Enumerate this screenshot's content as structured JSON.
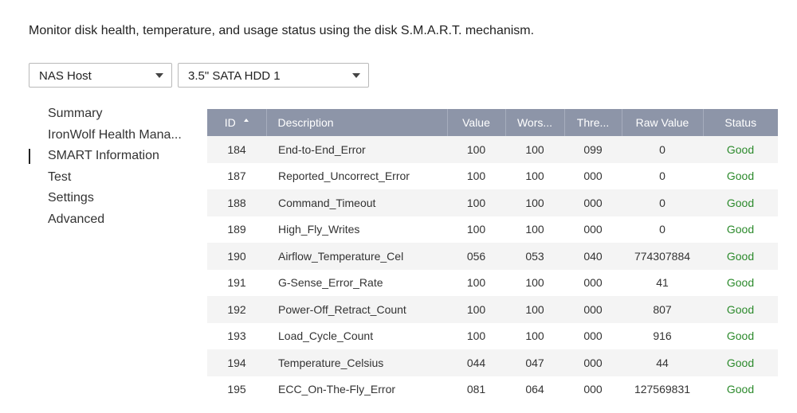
{
  "intro_text": "Monitor disk health, temperature, and usage status using the disk S.M.A.R.T. mechanism.",
  "selectors": {
    "host": "NAS Host",
    "disk": "3.5\" SATA HDD 1"
  },
  "nav": {
    "items": [
      {
        "label": "Summary"
      },
      {
        "label": "IronWolf Health Mana..."
      },
      {
        "label": "SMART Information"
      },
      {
        "label": "Test"
      },
      {
        "label": "Settings"
      },
      {
        "label": "Advanced"
      }
    ],
    "active_index": 2
  },
  "table": {
    "columns": [
      "ID",
      "Description",
      "Value",
      "Wors...",
      "Thre...",
      "Raw Value",
      "Status"
    ],
    "sorted_column": "ID",
    "sort_direction": "ascending",
    "rows": [
      {
        "id": "184",
        "description": "End-to-End_Error",
        "value": "100",
        "worst": "100",
        "threshold": "099",
        "raw": "0",
        "status": "Good"
      },
      {
        "id": "187",
        "description": "Reported_Uncorrect_Error",
        "value": "100",
        "worst": "100",
        "threshold": "000",
        "raw": "0",
        "status": "Good"
      },
      {
        "id": "188",
        "description": "Command_Timeout",
        "value": "100",
        "worst": "100",
        "threshold": "000",
        "raw": "0",
        "status": "Good"
      },
      {
        "id": "189",
        "description": "High_Fly_Writes",
        "value": "100",
        "worst": "100",
        "threshold": "000",
        "raw": "0",
        "status": "Good"
      },
      {
        "id": "190",
        "description": "Airflow_Temperature_Cel",
        "value": "056",
        "worst": "053",
        "threshold": "040",
        "raw": "774307884",
        "status": "Good"
      },
      {
        "id": "191",
        "description": "G-Sense_Error_Rate",
        "value": "100",
        "worst": "100",
        "threshold": "000",
        "raw": "41",
        "status": "Good"
      },
      {
        "id": "192",
        "description": "Power-Off_Retract_Count",
        "value": "100",
        "worst": "100",
        "threshold": "000",
        "raw": "807",
        "status": "Good"
      },
      {
        "id": "193",
        "description": "Load_Cycle_Count",
        "value": "100",
        "worst": "100",
        "threshold": "000",
        "raw": "916",
        "status": "Good"
      },
      {
        "id": "194",
        "description": "Temperature_Celsius",
        "value": "044",
        "worst": "047",
        "threshold": "000",
        "raw": "44",
        "status": "Good"
      },
      {
        "id": "195",
        "description": "ECC_On-The-Fly_Error",
        "value": "081",
        "worst": "064",
        "threshold": "000",
        "raw": "127569831",
        "status": "Good"
      }
    ]
  },
  "colors": {
    "header_bg": "#8d95a8",
    "status_good": "#2c8a2c",
    "row_alt": "#f4f4f4"
  },
  "icons": {
    "dropdown": "chevron-down-icon",
    "sort": "sort-ascending-icon"
  }
}
